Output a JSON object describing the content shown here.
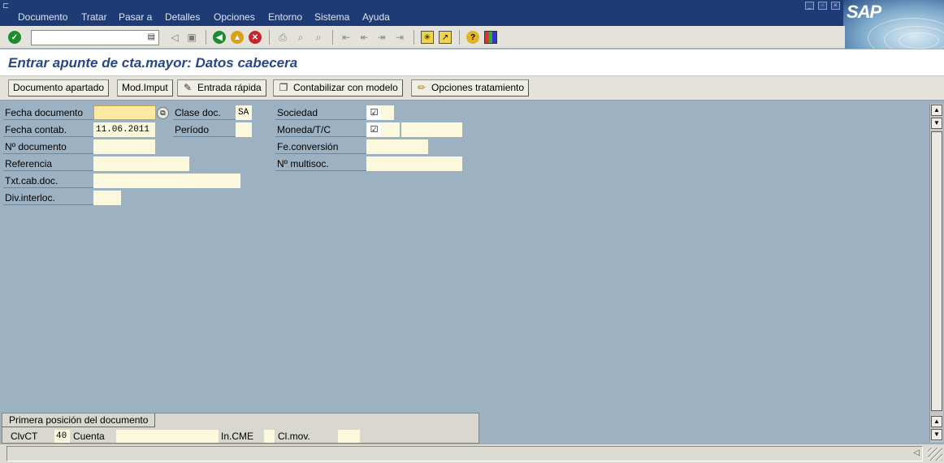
{
  "menubar": {
    "items": [
      {
        "label": "Documento"
      },
      {
        "label": "Tratar"
      },
      {
        "label": "Pasar a"
      },
      {
        "label": "Detalles"
      },
      {
        "label": "Opciones"
      },
      {
        "label": "Entorno"
      },
      {
        "label": "Sistema"
      },
      {
        "label": "Ayuda"
      }
    ],
    "logo_text": "SAP"
  },
  "toolbar": {
    "command_field_value": ""
  },
  "title": "Entrar apunte de cta.mayor: Datos cabecera",
  "app_toolbar": {
    "buttons": [
      {
        "label": "Documento apartado"
      },
      {
        "label": "Mod.Imput"
      },
      {
        "label": "Entrada rápida"
      },
      {
        "label": "Contabilizar con modelo"
      },
      {
        "label": "Opciones tratamiento"
      }
    ]
  },
  "form": {
    "fecha_documento": {
      "label": "Fecha documento",
      "value": ""
    },
    "fecha_contab": {
      "label": "Fecha contab.",
      "value": "11.06.2011"
    },
    "n_documento": {
      "label": "Nº documento",
      "value": ""
    },
    "referencia": {
      "label": "Referencia",
      "value": ""
    },
    "txt_cab_doc": {
      "label": "Txt.cab.doc.",
      "value": ""
    },
    "div_interloc": {
      "label": "Div.interloc.",
      "value": ""
    },
    "clase_doc": {
      "label": "Clase doc.",
      "value": "SA"
    },
    "periodo": {
      "label": "Período",
      "value": ""
    },
    "sociedad": {
      "label": "Sociedad",
      "value": "☑"
    },
    "moneda_tc": {
      "label": "Moneda/T/C",
      "value": "☑",
      "value2": ""
    },
    "fe_conversion": {
      "label": "Fe.conversión",
      "value": ""
    },
    "n_multisoc": {
      "label": "Nº multisoc.",
      "value": ""
    }
  },
  "first_item": {
    "tab_label": "Primera posición del documento",
    "clvct": {
      "label": "ClvCT",
      "value": "40"
    },
    "cuenta": {
      "label": "Cuenta",
      "value": ""
    },
    "in_cme": {
      "label": "In.CME",
      "value": ""
    },
    "cl_mov": {
      "label": "Cl.mov.",
      "value": ""
    }
  },
  "statusbar": {
    "message": ""
  }
}
